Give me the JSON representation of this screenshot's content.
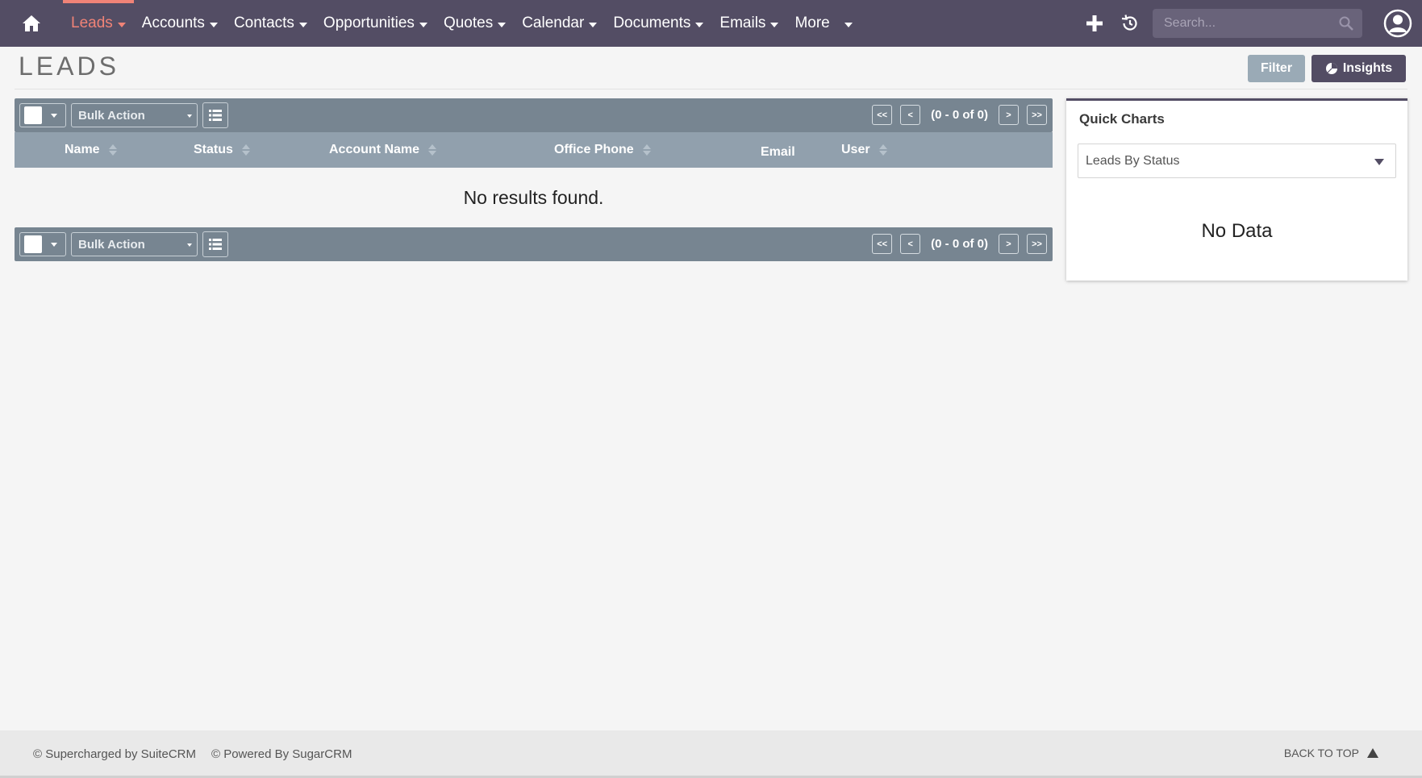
{
  "nav": {
    "home_icon": "home-icon",
    "items": [
      {
        "label": "Leads",
        "active": true
      },
      {
        "label": "Accounts"
      },
      {
        "label": "Contacts"
      },
      {
        "label": "Opportunities"
      },
      {
        "label": "Quotes"
      },
      {
        "label": "Calendar"
      },
      {
        "label": "Documents"
      },
      {
        "label": "Emails"
      },
      {
        "label": "More"
      }
    ],
    "search_placeholder": "Search...",
    "icons": [
      "plus-icon",
      "history-icon",
      "search-icon",
      "user-avatar-icon"
    ],
    "colors": {
      "bar": "#534d64",
      "active": "#f08377"
    }
  },
  "page": {
    "title": "LEADS",
    "filter_label": "Filter",
    "insights_label": "Insights"
  },
  "list": {
    "bulk_action_label": "Bulk Action",
    "pager": {
      "first": "<<",
      "prev": "<",
      "count": "(0 - 0 of 0)",
      "next": ">",
      "last": ">>"
    },
    "columns": [
      {
        "label": "Name",
        "sortable": true
      },
      {
        "label": "Status",
        "sortable": true
      },
      {
        "label": "Account Name",
        "sortable": true
      },
      {
        "label": "Office Phone",
        "sortable": true
      },
      {
        "label": "Email",
        "sortable": false
      },
      {
        "label": "User",
        "sortable": true
      }
    ],
    "empty_message": "No results found."
  },
  "quick_charts": {
    "title": "Quick Charts",
    "selected_chart": "Leads By Status",
    "no_data": "No Data"
  },
  "footer": {
    "suitecrm": "© Supercharged by SuiteCRM",
    "sugarcrm": "© Powered By SugarCRM",
    "back_to_top": "BACK TO TOP"
  }
}
